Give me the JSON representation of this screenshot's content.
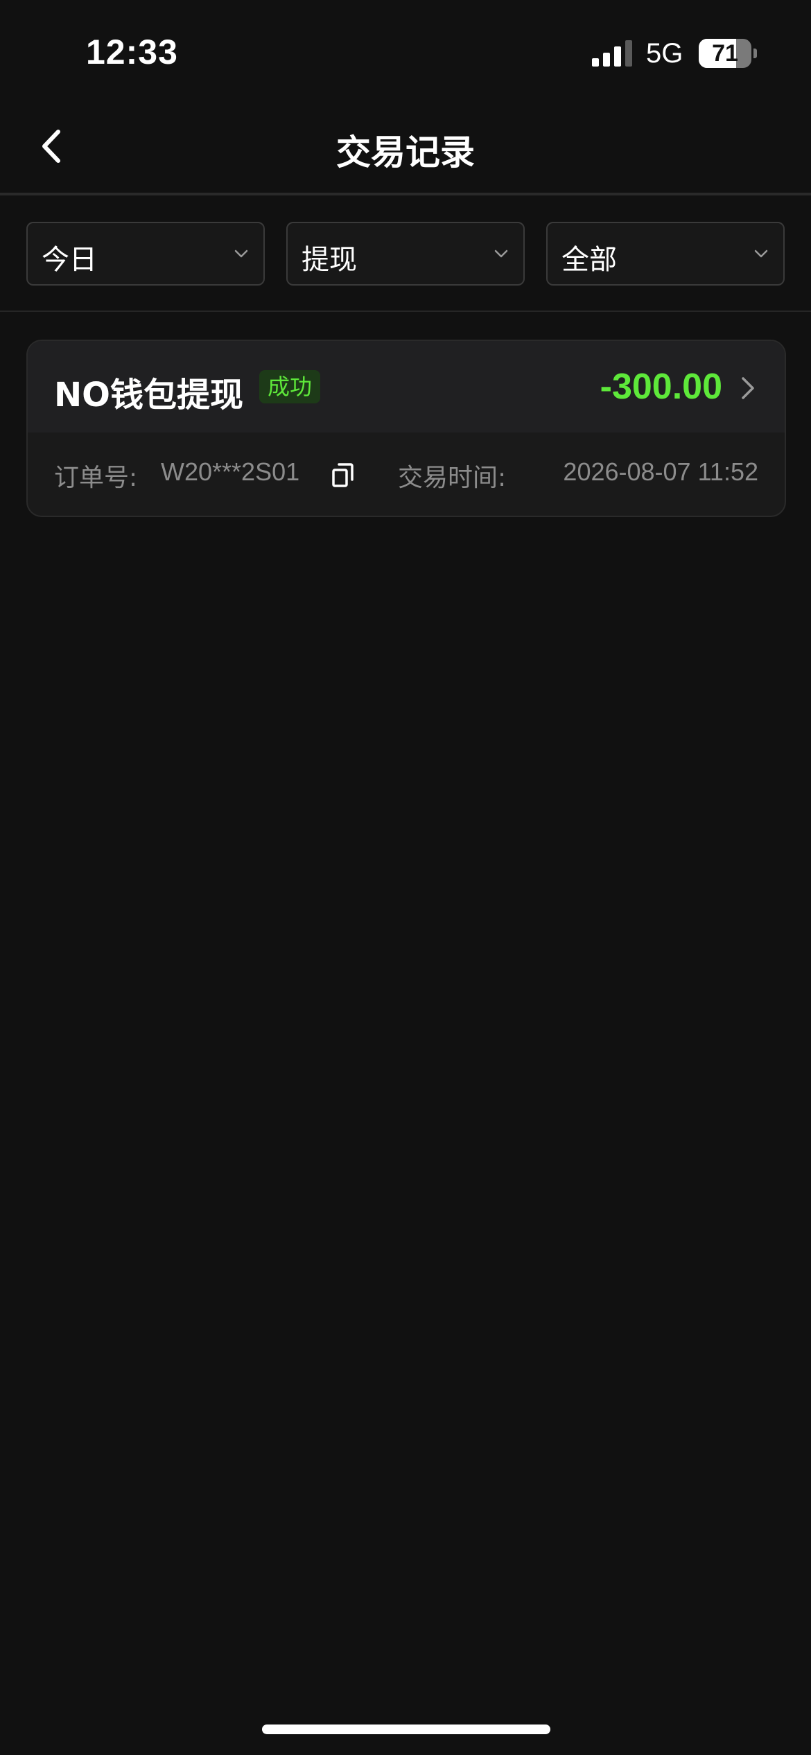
{
  "status_bar": {
    "time": "12:33",
    "network": "5G",
    "battery_level": "71",
    "battery_fraction": 0.71,
    "signal_bars_active": 3,
    "signal_bars_total": 4
  },
  "nav": {
    "title": "交易记录",
    "back_icon": "chevron-left-icon"
  },
  "filters": {
    "date": {
      "label": "今日"
    },
    "type": {
      "label": "提现"
    },
    "status": {
      "label": "全部"
    }
  },
  "transactions": [
    {
      "title": "NO钱包提现",
      "status": "成功",
      "amount": "-300.00",
      "order_label": "订单号:",
      "order_no": "W20***2S01",
      "time_label": "交易时间:",
      "time": "2026-08-07 11:52"
    }
  ],
  "colors": {
    "background": "#111111",
    "card": "#1a1a1a",
    "card_header": "#202022",
    "success_green": "#5ee83a",
    "muted_text": "#8c8c8c"
  }
}
